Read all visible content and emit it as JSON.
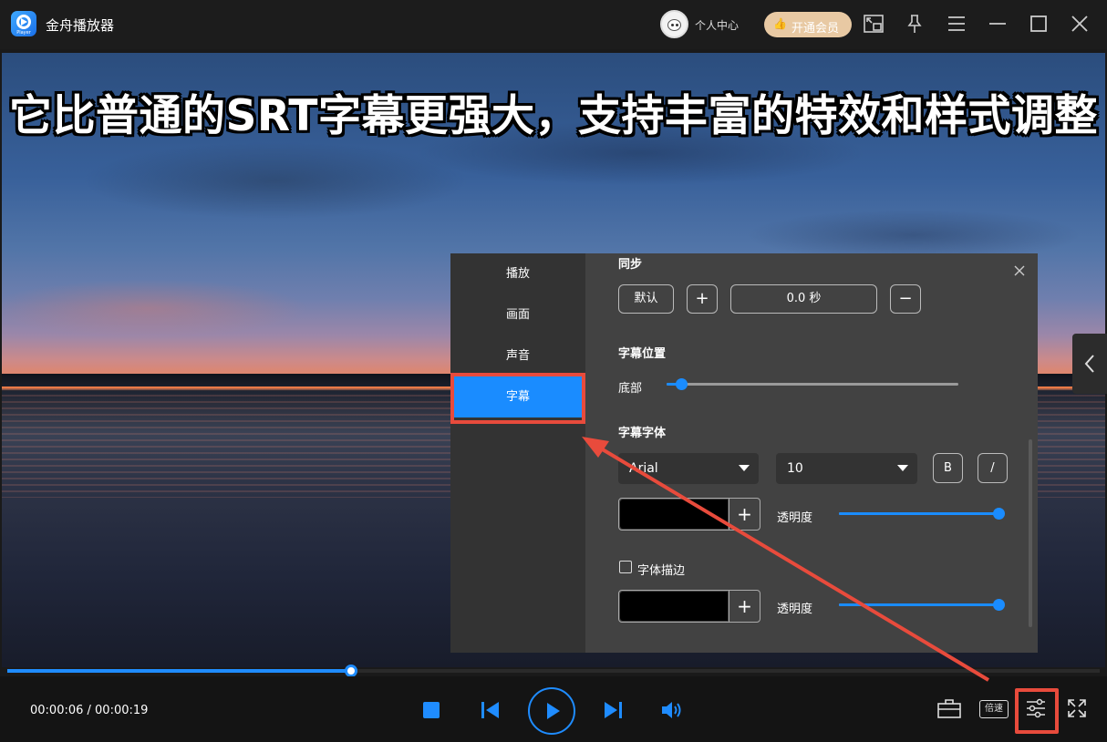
{
  "app": {
    "title": "金舟播放器",
    "logo_text": "Player",
    "user_center": "个人中心",
    "vip_button": "开通会员"
  },
  "titlebar_icons": [
    "mini-mode-icon",
    "pin-icon",
    "menu-icon",
    "minimize-icon",
    "maximize-icon",
    "close-icon"
  ],
  "video": {
    "subtitle_text": "它比普通的SRT字幕更强大，支持丰富的特效和样式调整"
  },
  "player": {
    "current_time": "00:00:06",
    "total_time": "00:00:19",
    "time_display": "00:00:06 / 00:00:19",
    "progress": 0.315,
    "speed_label": "倍速",
    "accent": "#1f8cff"
  },
  "settings": {
    "nav": [
      "播放",
      "画面",
      "声音",
      "字幕"
    ],
    "active_nav": "字幕",
    "sync": {
      "title": "同步",
      "default_button": "默认",
      "plus": "+",
      "value": "0.0 秒",
      "minus": "−"
    },
    "position": {
      "title": "字幕位置",
      "label": "底部",
      "level": 0.05
    },
    "font": {
      "title": "字幕字体",
      "family": "Arial",
      "size": "10",
      "bold": "B",
      "italic": "/",
      "color_plus": "+",
      "opacity_label": "透明度",
      "opacity_level": 1.0
    },
    "outline": {
      "label": "字体描边",
      "checked": false,
      "color_plus": "+",
      "opacity_label": "透明度",
      "opacity_level": 1.0
    }
  },
  "annotation_color": "#e84b3c"
}
